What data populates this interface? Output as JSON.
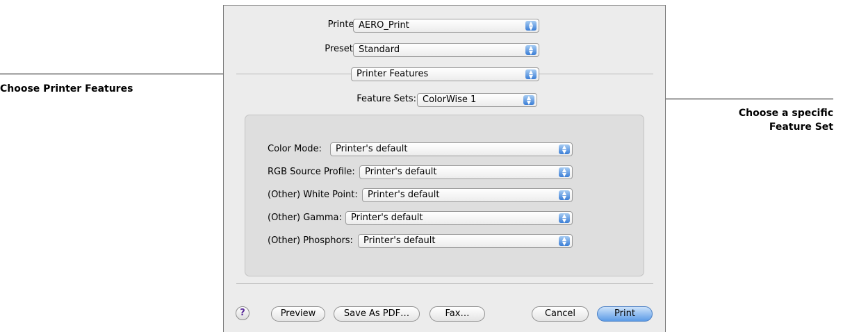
{
  "dialog": {
    "printer": {
      "label": "Printer:",
      "value": "AERO_Print"
    },
    "presets": {
      "label": "Presets:",
      "value": "Standard"
    },
    "panel_select": {
      "value": "Printer Features"
    },
    "feature_sets": {
      "label": "Feature Sets:",
      "value": "ColorWise 1"
    },
    "features": [
      {
        "label": "Color Mode:",
        "value": "Printer's default"
      },
      {
        "label": "RGB Source Profile:",
        "value": "Printer's default"
      },
      {
        "label": "(Other) White Point:",
        "value": "Printer's default"
      },
      {
        "label": "(Other) Gamma:",
        "value": "Printer's default"
      },
      {
        "label": "(Other) Phosphors:",
        "value": "Printer's default"
      }
    ],
    "buttons": {
      "help": "?",
      "preview": "Preview",
      "save_pdf": "Save As PDF…",
      "fax": "Fax…",
      "cancel": "Cancel",
      "print": "Print"
    }
  },
  "callouts": {
    "left": "Choose Printer Features",
    "right_line1": "Choose a specific",
    "right_line2": "Feature Set"
  }
}
